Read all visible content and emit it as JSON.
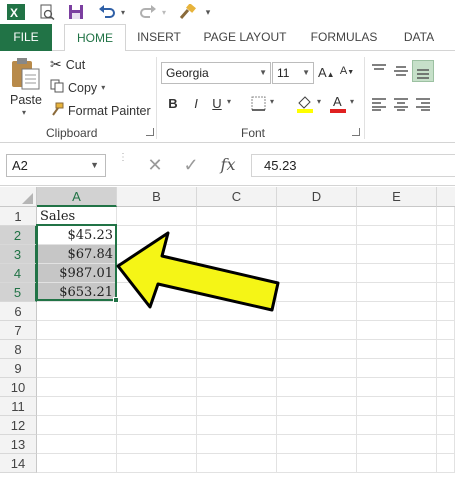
{
  "quick_access": {
    "app_icon": "excel-icon",
    "save": "save-icon",
    "undo": "undo-icon",
    "redo": "redo-icon",
    "touch": "touch-mode-icon",
    "customize": "customize-qat-icon"
  },
  "tabs": [
    "FILE",
    "HOME",
    "INSERT",
    "PAGE LAYOUT",
    "FORMULAS",
    "DATA"
  ],
  "clipboard": {
    "paste": "Paste",
    "cut": "Cut",
    "copy": "Copy",
    "format_painter": "Format Painter",
    "group": "Clipboard"
  },
  "font": {
    "name": "Georgia",
    "size": "11",
    "bold": "B",
    "italic": "I",
    "underline": "U",
    "font_color_glyph": "A",
    "group": "Font"
  },
  "formula_bar": {
    "name_box": "A2",
    "cancel": "✕",
    "enter": "✓",
    "fx": "fx",
    "value": "45.23"
  },
  "columns": [
    "A",
    "B",
    "C",
    "D",
    "E"
  ],
  "rows": [
    "1",
    "2",
    "3",
    "4",
    "5",
    "6",
    "7",
    "8",
    "9",
    "10",
    "11",
    "12",
    "13",
    "14"
  ],
  "cells": {
    "A1": "Sales",
    "A2": "$45.23",
    "A3": "$67.84",
    "A4": "$987.01",
    "A5": "$653.21"
  },
  "colors": {
    "accent": "#217346",
    "arrow_fill": "#f5f516",
    "arrow_stroke": "#000000"
  }
}
